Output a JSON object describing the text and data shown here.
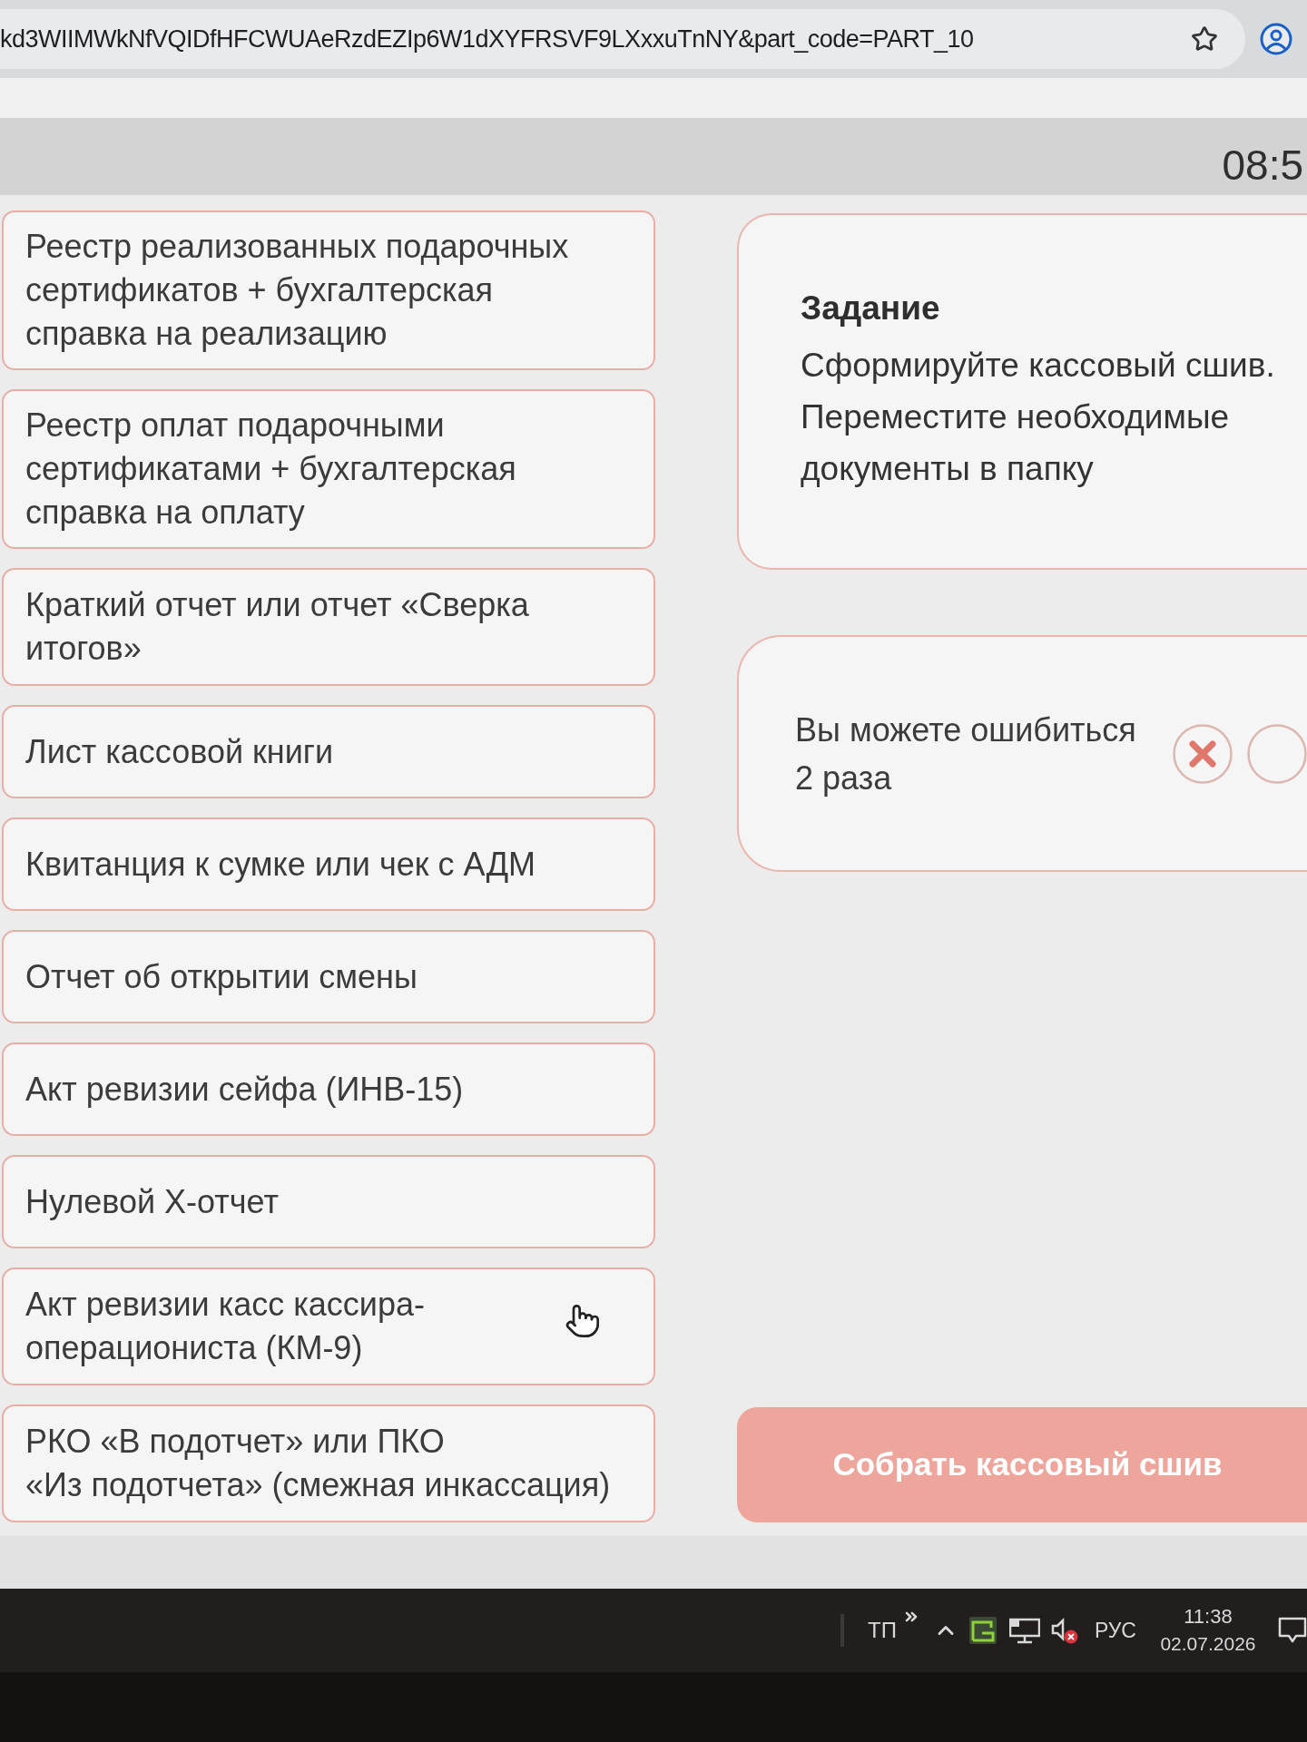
{
  "browser": {
    "url": "kd3WIIMWkNfVQIDfHFCWUAeRzdEZIp6W1dXYFRSVF9LXxxuTnNY&part_code=PART_10"
  },
  "header": {
    "timer": "08:5"
  },
  "documents": [
    {
      "text": "Реестр реализованных подарочных\nсертификатов + бухгалтерская\nсправка на реализацию"
    },
    {
      "text": "Реестр оплат подарочными\nсертификатами + бухгалтерская\nсправка на оплату"
    },
    {
      "text": "Краткий отчет или отчет «Сверка\nитогов»"
    },
    {
      "text": "Лист кассовой книги"
    },
    {
      "text": "Квитанция к сумке или чек с АДМ"
    },
    {
      "text": "Отчет об открытии смены"
    },
    {
      "text": "Акт ревизии сейфа (ИНВ-15)"
    },
    {
      "text": "Нулевой Х-отчет"
    },
    {
      "text": "Акт ревизии касс кассира-\nоперациониста (КМ-9)"
    },
    {
      "text": "РКО «В подотчет» или ПКО\n«Из подотчета» (смежная инкассация)"
    }
  ],
  "task": {
    "title": "Задание",
    "text": "Сформируйте кассовый сшив.\nПереместите необходимые\nдокументы в папку"
  },
  "attempts": {
    "text": "Вы можете ошибиться\n2 раза",
    "marks": [
      {
        "used": true
      },
      {
        "used": false
      }
    ]
  },
  "submit_button": {
    "label": "Собрать кассовый сшив",
    "disabled": true
  },
  "taskbar": {
    "toolbar": "ТП",
    "language": "РУС",
    "time": "11:38",
    "date": "02.07.2026"
  }
}
